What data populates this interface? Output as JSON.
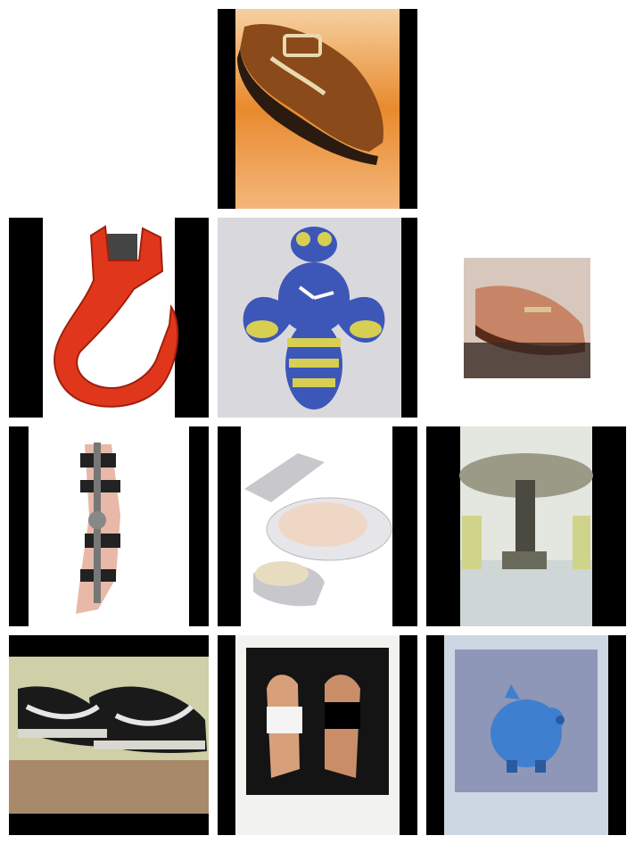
{
  "grid": {
    "tiles": [
      {
        "subject": "clog-shoe-image"
      },
      {
        "subject": "crane-hook-image"
      },
      {
        "subject": "bee-clock-image"
      },
      {
        "subject": "loafer-shoe-image"
      },
      {
        "subject": "knee-brace-image"
      },
      {
        "subject": "cosmetic-compact-image"
      },
      {
        "subject": "lab-machine-image"
      },
      {
        "subject": "sneaker-photo-image"
      },
      {
        "subject": "polaroid-people-image"
      },
      {
        "subject": "blue-piggy-bank-image"
      }
    ]
  },
  "colors": {
    "letterbox": "#000000",
    "background": "#ffffff",
    "clog_bg": "#e88a2e",
    "hook_red": "#e0371c",
    "bee_blue": "#3d57b8",
    "bee_yellow": "#d6cf52",
    "piggy_blue": "#3f7fd0"
  }
}
